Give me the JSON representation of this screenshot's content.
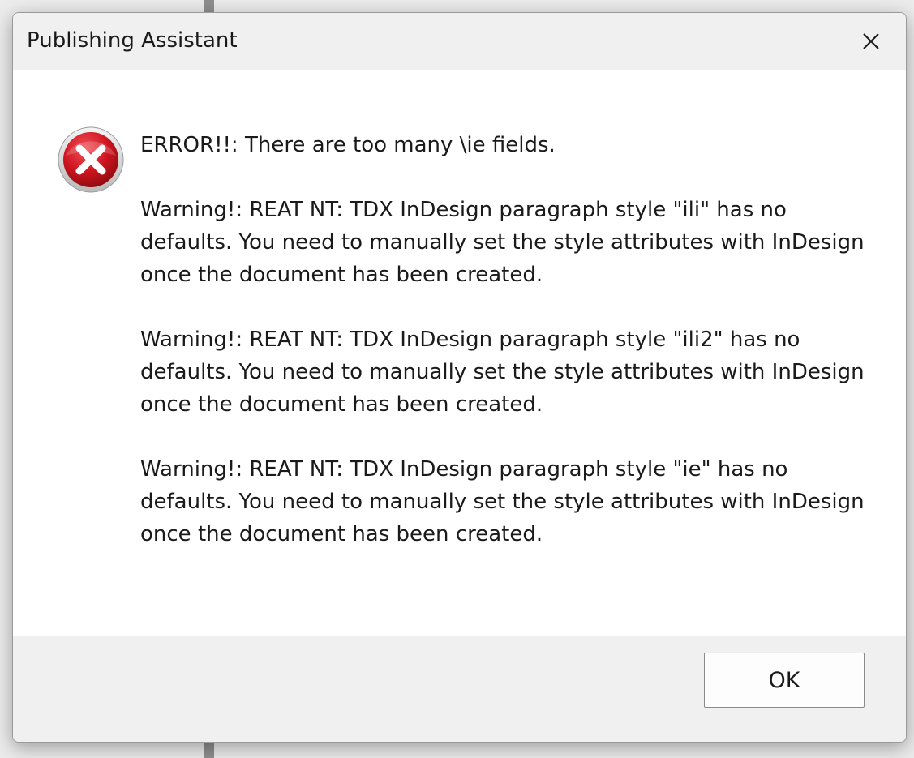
{
  "window": {
    "title": "Publishing Assistant",
    "close_icon": "close-icon"
  },
  "dialog": {
    "icon": "error-icon",
    "messages": [
      "ERROR!!: There are too many \\ie fields.",
      "Warning!: REAT NT: TDX InDesign paragraph style \"ili\" has no defaults. You need to manually set the style attributes with InDesign once the document has been created.",
      "Warning!: REAT NT: TDX InDesign paragraph style \"ili2\" has no defaults. You need to manually set the style attributes with InDesign once the document has been created.",
      "Warning!: REAT NT: TDX InDesign paragraph style \"ie\" has no defaults. You need to manually set the style attributes with InDesign once the document has been created."
    ],
    "ok_label": "OK"
  },
  "colors": {
    "error_red": "#c8101b",
    "dialog_bg": "#ffffff",
    "chrome_bg": "#f0f0f0"
  }
}
